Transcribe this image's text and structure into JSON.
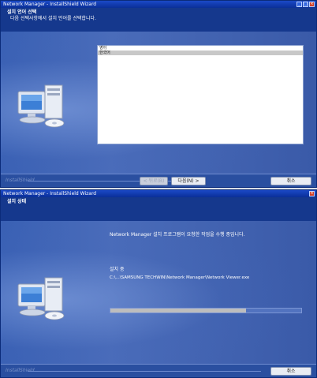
{
  "window1": {
    "title": "Network Manager - InstallShield Wizard",
    "header_title": "설치 언어 선택",
    "header_subtitle": "다음 선택사항에서 설치 언어를 선택합니다.",
    "list_items": [
      {
        "label": "영어",
        "selected": false
      },
      {
        "label": "한국어",
        "selected": true
      }
    ],
    "brand": "InstallShield",
    "back_label": "< 뒤로(B)",
    "next_label": "다음(N) >",
    "cancel_label": "취소"
  },
  "window2": {
    "title": "Network Manager - InstallShield Wizard",
    "header_title": "설치 상태",
    "status_text": "Network Manager 설치 프로그램이 요청한 작업을 수행 중입니다.",
    "installing_label": "설치 중",
    "install_path": "C:\\...\\SAMSUNG TECHWIN\\Network Manager\\Network Viewer.exe",
    "progress_fraction": 0.71,
    "brand": "InstallShield",
    "cancel_label": "취소"
  }
}
